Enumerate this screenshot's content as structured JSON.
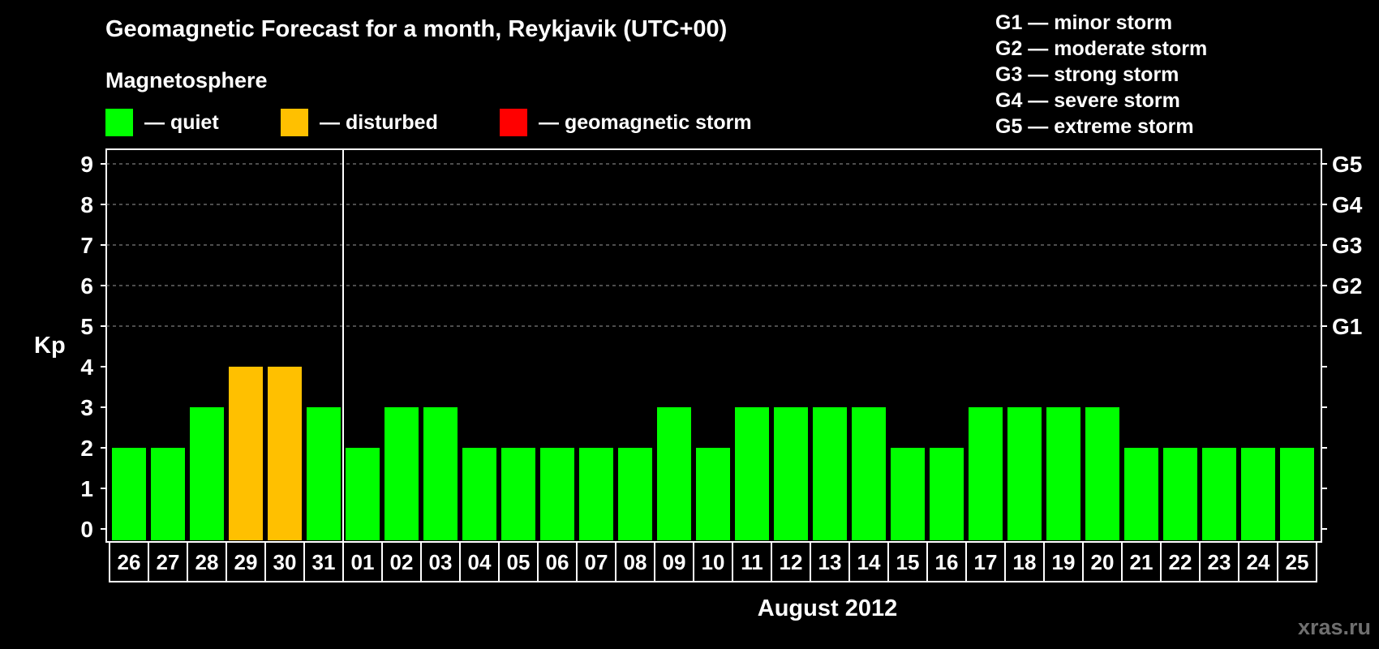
{
  "title": "Geomagnetic Forecast for a month, Reykjavik (UTC+00)",
  "magnetosphere_heading": "Magnetosphere",
  "legend": [
    {
      "label": "— quiet",
      "color": "#00ff00"
    },
    {
      "label": "— disturbed",
      "color": "#ffc000"
    },
    {
      "label": "— geomagnetic storm",
      "color": "#ff0000"
    }
  ],
  "storm_scale": [
    "G1 — minor storm",
    "G2 — moderate storm",
    "G3 — strong storm",
    "G4 — severe storm",
    "G5 — extreme storm"
  ],
  "watermark": "xras.ru",
  "chart_data": {
    "type": "bar",
    "title": "Geomagnetic Forecast for a month, Reykjavik (UTC+00)",
    "xlabel": "August 2012",
    "ylabel": "Kp",
    "ylim": [
      0,
      9
    ],
    "yticks": [
      "0",
      "1",
      "2",
      "3",
      "4",
      "5",
      "6",
      "7",
      "8",
      "9"
    ],
    "right_axis_labels": [
      {
        "kp": 5,
        "label": "G1"
      },
      {
        "kp": 6,
        "label": "G2"
      },
      {
        "kp": 7,
        "label": "G3"
      },
      {
        "kp": 8,
        "label": "G4"
      },
      {
        "kp": 9,
        "label": "G5"
      }
    ],
    "categories": [
      "26",
      "27",
      "28",
      "29",
      "30",
      "31",
      "01",
      "02",
      "03",
      "04",
      "05",
      "06",
      "07",
      "08",
      "09",
      "10",
      "11",
      "12",
      "13",
      "14",
      "15",
      "16",
      "17",
      "18",
      "19",
      "20",
      "21",
      "22",
      "23",
      "24",
      "25"
    ],
    "values": [
      2,
      2,
      3,
      4,
      4,
      3,
      2,
      3,
      3,
      2,
      2,
      2,
      2,
      2,
      3,
      2,
      3,
      3,
      3,
      3,
      2,
      2,
      3,
      3,
      3,
      3,
      2,
      2,
      2,
      2,
      2
    ],
    "status": [
      "quiet",
      "quiet",
      "quiet",
      "disturbed",
      "disturbed",
      "quiet",
      "quiet",
      "quiet",
      "quiet",
      "quiet",
      "quiet",
      "quiet",
      "quiet",
      "quiet",
      "quiet",
      "quiet",
      "quiet",
      "quiet",
      "quiet",
      "quiet",
      "quiet",
      "quiet",
      "quiet",
      "quiet",
      "quiet",
      "quiet",
      "quiet",
      "quiet",
      "quiet",
      "quiet",
      "quiet"
    ],
    "colors": {
      "quiet": "#00ff00",
      "disturbed": "#ffc000",
      "storm": "#ff0000"
    },
    "grid": true,
    "month_separator_after": "31"
  }
}
